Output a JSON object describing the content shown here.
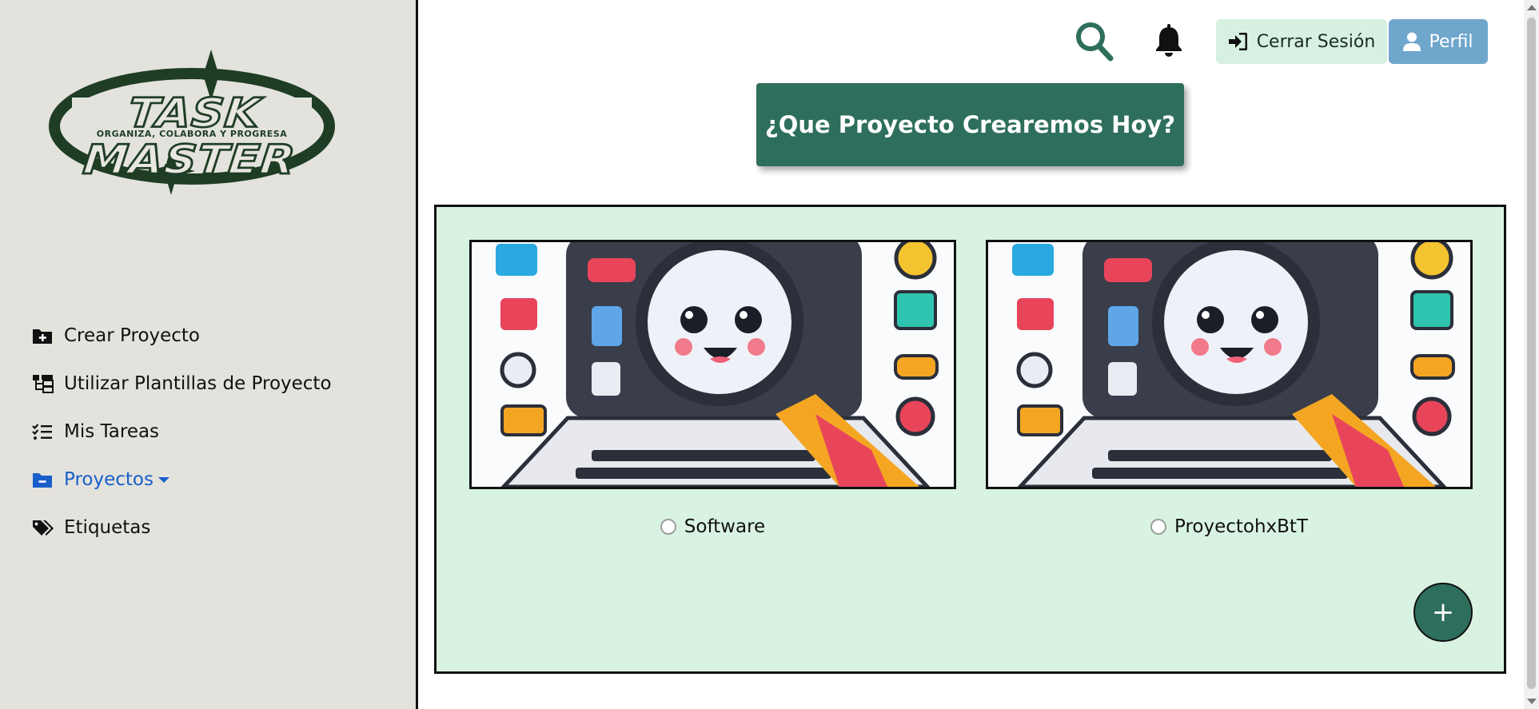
{
  "logo": {
    "title": "TASK MASTER",
    "tagline": "ORGANIZA, COLABORA Y PROGRESA"
  },
  "sidebar": {
    "items": [
      {
        "label": "Crear Proyecto",
        "icon": "folder-plus-icon"
      },
      {
        "label": "Utilizar Plantillas de Proyecto",
        "icon": "sitemap-icon"
      },
      {
        "label": "Mis Tareas",
        "icon": "list-check-icon"
      },
      {
        "label": "Proyectos",
        "icon": "folder-minus-icon",
        "active": true
      },
      {
        "label": "Etiquetas",
        "icon": "tags-icon"
      }
    ]
  },
  "header": {
    "logout_label": "Cerrar Sesión",
    "profile_label": "Perfil"
  },
  "hero": {
    "label": "¿Que Proyecto Crearemos Hoy?"
  },
  "projects": [
    {
      "name": "Software"
    },
    {
      "name": "ProyectohxBtT"
    }
  ],
  "fab": {
    "label": "+"
  },
  "colors": {
    "sidebar_bg": "#e3e2dd",
    "accent": "#2e6e5c",
    "panel_bg": "#d9f3e2",
    "active_link": "#1a5fc9",
    "profile_btn": "#6fa6cc",
    "logout_btn": "#d6f1e1"
  }
}
